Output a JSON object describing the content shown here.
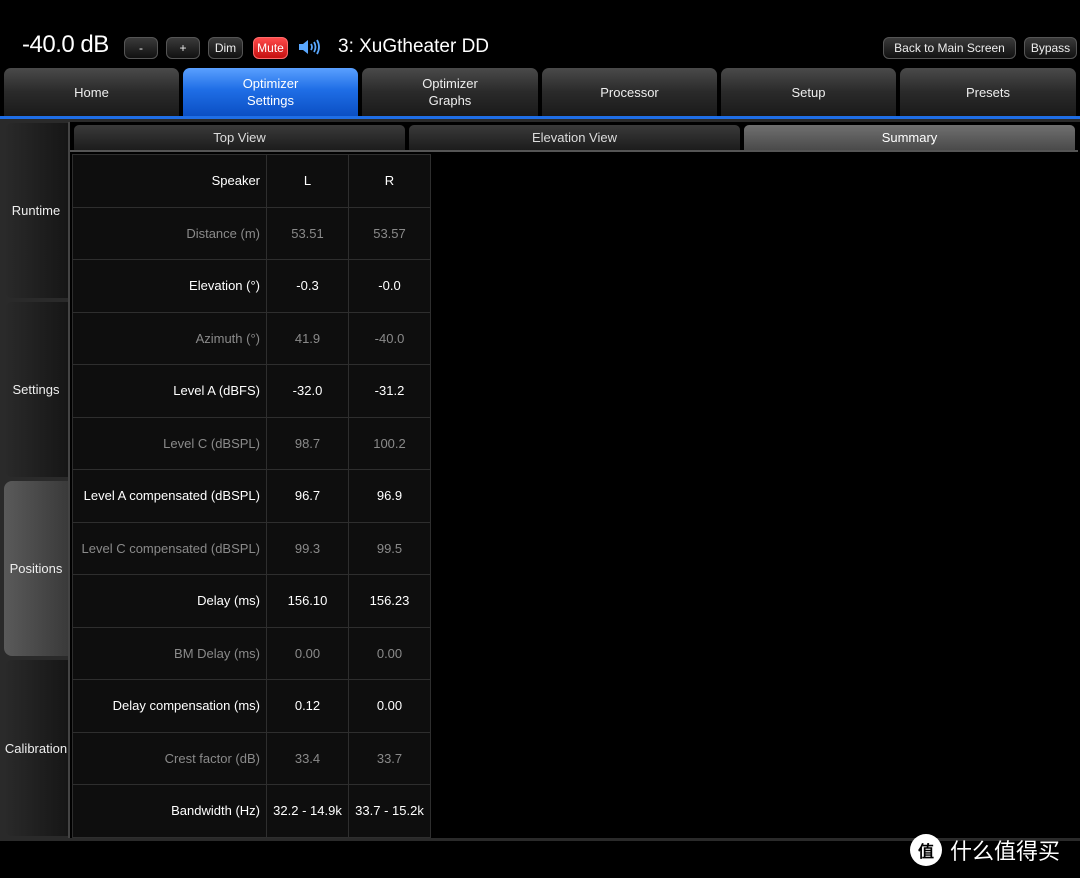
{
  "header": {
    "volume": "-40.0 dB",
    "vol_down_label": "-",
    "vol_up_label": "+",
    "dim_label": "Dim",
    "mute_label": "Mute",
    "speaker_icon": "speaker-volume-icon",
    "preset_title": "3: XuGtheater DD",
    "back_label": "Back to Main Screen",
    "bypass_label": "Bypass",
    "mute_color": "#e02020"
  },
  "main_tabs": [
    {
      "line1": "Home",
      "line2": ""
    },
    {
      "line1": "Optimizer",
      "line2": "Settings"
    },
    {
      "line1": "Optimizer",
      "line2": "Graphs"
    },
    {
      "line1": "Processor",
      "line2": ""
    },
    {
      "line1": "Setup",
      "line2": ""
    },
    {
      "line1": "Presets",
      "line2": ""
    }
  ],
  "active_main_tab": "Optimizer Settings",
  "accent_color": "#1f6ee6",
  "side_tabs": [
    "Runtime",
    "Settings",
    "Positions",
    "Calibration"
  ],
  "active_side_tab": "Positions",
  "sub_tabs": [
    "Top View",
    "Elevation View",
    "Summary"
  ],
  "active_sub_tab": "Summary",
  "table": {
    "header": {
      "label": "Speaker",
      "l": "L",
      "r": "R"
    },
    "rows": [
      {
        "label": "Distance (m)",
        "l": "53.51",
        "r": "53.57"
      },
      {
        "label": "Elevation (°)",
        "l": "-0.3",
        "r": "-0.0"
      },
      {
        "label": "Azimuth (°)",
        "l": "41.9",
        "r": "-40.0"
      },
      {
        "label": "Level A (dBFS)",
        "l": "-32.0",
        "r": "-31.2"
      },
      {
        "label": "Level C (dBSPL)",
        "l": "98.7",
        "r": "100.2"
      },
      {
        "label": "Level A compensated (dBSPL)",
        "l": "96.7",
        "r": "96.9"
      },
      {
        "label": "Level C compensated (dBSPL)",
        "l": "99.3",
        "r": "99.5"
      },
      {
        "label": "Delay (ms)",
        "l": "156.10",
        "r": "156.23"
      },
      {
        "label": "BM Delay (ms)",
        "l": "0.00",
        "r": "0.00"
      },
      {
        "label": "Delay compensation (ms)",
        "l": "0.12",
        "r": "0.00"
      },
      {
        "label": "Crest factor (dB)",
        "l": "33.4",
        "r": "33.7"
      },
      {
        "label": "Bandwidth (Hz)",
        "l": "32.2 - 14.9k",
        "r": "33.7 - 15.2k"
      }
    ]
  },
  "watermark": {
    "logo": "值",
    "text": "什么值得买"
  }
}
